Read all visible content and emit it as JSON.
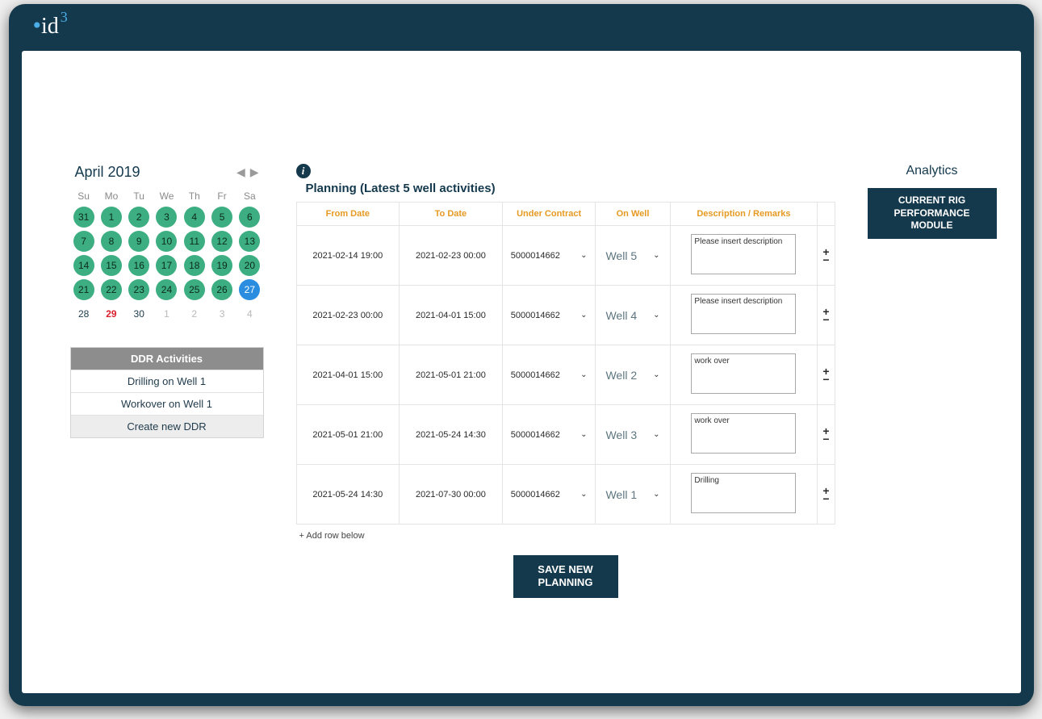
{
  "logo": {
    "base": "id",
    "dot_glyph": "•",
    "sup": "3"
  },
  "calendar": {
    "title": "April 2019",
    "daynames": [
      "Su",
      "Mo",
      "Tu",
      "We",
      "Th",
      "Fr",
      "Sa"
    ],
    "weeks": [
      [
        {
          "d": "31",
          "cls": "green"
        },
        {
          "d": "1",
          "cls": "green"
        },
        {
          "d": "2",
          "cls": "green"
        },
        {
          "d": "3",
          "cls": "green"
        },
        {
          "d": "4",
          "cls": "green"
        },
        {
          "d": "5",
          "cls": "green"
        },
        {
          "d": "6",
          "cls": "green"
        }
      ],
      [
        {
          "d": "7",
          "cls": "green"
        },
        {
          "d": "8",
          "cls": "green"
        },
        {
          "d": "9",
          "cls": "green"
        },
        {
          "d": "10",
          "cls": "green"
        },
        {
          "d": "11",
          "cls": "green"
        },
        {
          "d": "12",
          "cls": "green"
        },
        {
          "d": "13",
          "cls": "green"
        }
      ],
      [
        {
          "d": "14",
          "cls": "green"
        },
        {
          "d": "15",
          "cls": "green"
        },
        {
          "d": "16",
          "cls": "green"
        },
        {
          "d": "17",
          "cls": "green"
        },
        {
          "d": "18",
          "cls": "green"
        },
        {
          "d": "19",
          "cls": "green"
        },
        {
          "d": "20",
          "cls": "green"
        }
      ],
      [
        {
          "d": "21",
          "cls": "green"
        },
        {
          "d": "22",
          "cls": "green"
        },
        {
          "d": "23",
          "cls": "green"
        },
        {
          "d": "24",
          "cls": "green"
        },
        {
          "d": "25",
          "cls": "green"
        },
        {
          "d": "26",
          "cls": "green"
        },
        {
          "d": "27",
          "cls": "blue"
        }
      ],
      [
        {
          "d": "28",
          "cls": ""
        },
        {
          "d": "29",
          "cls": "red"
        },
        {
          "d": "30",
          "cls": ""
        },
        {
          "d": "1",
          "cls": "out"
        },
        {
          "d": "2",
          "cls": "out"
        },
        {
          "d": "3",
          "cls": "out"
        },
        {
          "d": "4",
          "cls": "out"
        }
      ]
    ]
  },
  "ddr": {
    "title": "DDR Activities",
    "rows": [
      "Drilling on Well 1",
      "Workover on Well 1"
    ],
    "create": "Create new DDR"
  },
  "planning": {
    "info_glyph": "i",
    "title": "Planning (Latest 5 well activities)",
    "headers": [
      "From Date",
      "To Date",
      "Under Contract",
      "On Well",
      "Description / Remarks"
    ],
    "rows": [
      {
        "from": "2021-02-14 19:00",
        "to": "2021-02-23 00:00",
        "contract": "5000014662",
        "well": "Well 5",
        "desc": "Please insert description"
      },
      {
        "from": "2021-02-23 00:00",
        "to": "2021-04-01 15:00",
        "contract": "5000014662",
        "well": "Well 4",
        "desc": "Please insert description"
      },
      {
        "from": "2021-04-01 15:00",
        "to": "2021-05-01 21:00",
        "contract": "5000014662",
        "well": "Well 2",
        "desc": "work over"
      },
      {
        "from": "2021-05-01 21:00",
        "to": "2021-05-24 14:30",
        "contract": "5000014662",
        "well": "Well 3",
        "desc": "work over"
      },
      {
        "from": "2021-05-24 14:30",
        "to": "2021-07-30 00:00",
        "contract": "5000014662",
        "well": "Well 1",
        "desc": "Drilling"
      }
    ],
    "addrow": "+ Add row below",
    "save": "SAVE NEW PLANNING"
  },
  "right": {
    "title": "Analytics",
    "module": "CURRENT RIG PERFORMANCE MODULE"
  }
}
